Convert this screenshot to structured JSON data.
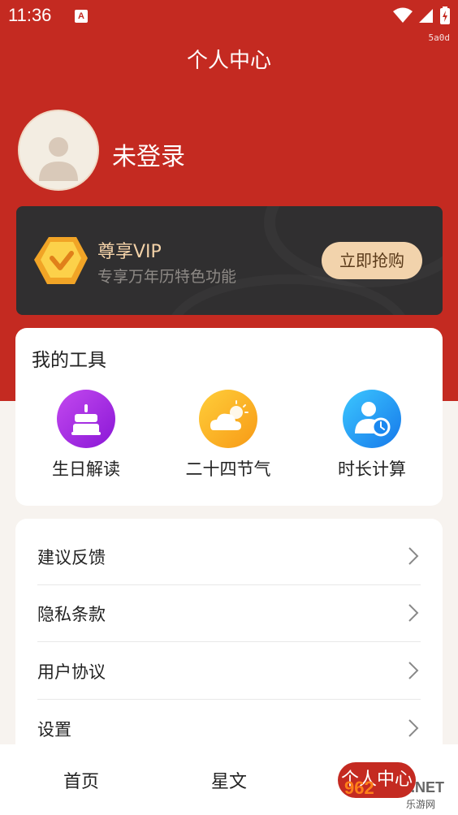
{
  "status_bar": {
    "time": "11:36",
    "a_badge": "A",
    "debug_text": "5a0d"
  },
  "header": {
    "title": "个人中心"
  },
  "profile": {
    "login_text": "未登录"
  },
  "vip": {
    "title": "尊享VIP",
    "subtitle": "专享万年历特色功能",
    "button": "立即抢购"
  },
  "tools": {
    "title": "我的工具",
    "items": [
      {
        "label": "生日解读",
        "icon": "birthday-cake-icon",
        "color": "#a225e0"
      },
      {
        "label": "二十四节气",
        "icon": "cloud-sun-icon",
        "color": "#f7a018"
      },
      {
        "label": "时长计算",
        "icon": "user-clock-icon",
        "color": "#1e8ff0"
      }
    ]
  },
  "menu": {
    "items": [
      {
        "label": "建议反馈"
      },
      {
        "label": "隐私条款"
      },
      {
        "label": "用户协议"
      },
      {
        "label": "设置"
      }
    ]
  },
  "bottom_nav": {
    "items": [
      {
        "label": "首页"
      },
      {
        "label": "星文"
      },
      {
        "label": "个人中心"
      }
    ],
    "active_color": "#c42a21"
  },
  "watermark": {
    "logo": "962",
    "net": ".NET",
    "sub": "乐游网"
  },
  "colors": {
    "primary": "#c42a21",
    "vip_bg": "#302f30",
    "vip_accent": "#f2d3ac"
  }
}
